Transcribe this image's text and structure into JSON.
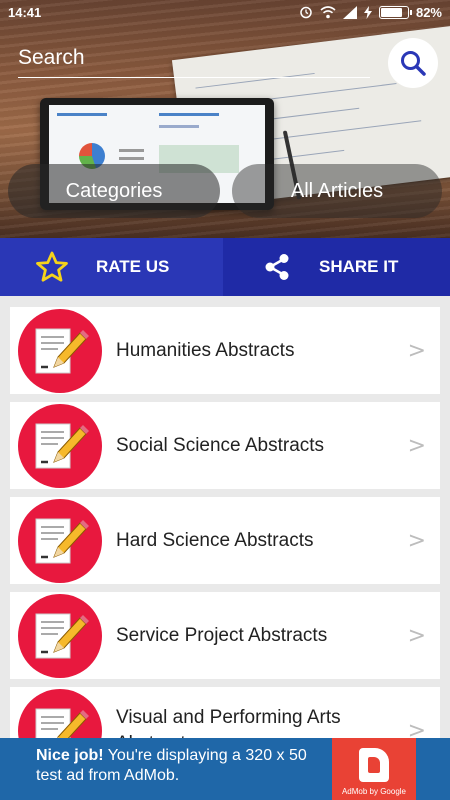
{
  "status_bar": {
    "time": "14:41",
    "battery": "82%",
    "battery_level": 0.82
  },
  "header": {
    "search": {
      "placeholder": "Search"
    },
    "tabs": [
      {
        "label": "Categories"
      },
      {
        "label": "All Articles"
      }
    ]
  },
  "actions": {
    "rate_label": "RATE US",
    "share_label": "SHARE IT"
  },
  "list": {
    "items": [
      {
        "label": "Humanities Abstracts"
      },
      {
        "label": "Social Science Abstracts"
      },
      {
        "label": "Hard Science Abstracts"
      },
      {
        "label": "Service Project Abstracts"
      },
      {
        "label": "Visual and Performing Arts Abstracts"
      }
    ],
    "chevron": ">"
  },
  "ad": {
    "headline": "Nice job!",
    "body": " You're displaying a 320 x 50 test ad from AdMob.",
    "caption": "AdMob by Google"
  },
  "colors": {
    "action_bar": "#2a37b6",
    "icon_circle": "#e8183e",
    "ad_background": "#1f67a8",
    "ad_logo": "#e94235"
  }
}
